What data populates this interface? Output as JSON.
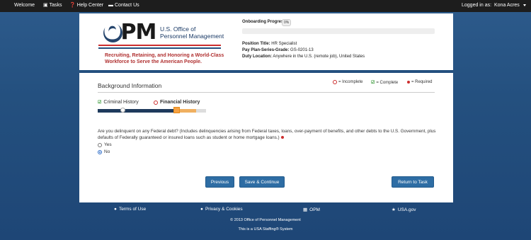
{
  "topnav": {
    "welcome": "Welcome",
    "tasks": "Tasks",
    "help_center": "Help Center",
    "contact_us": "Contact Us",
    "logged_in_as": "Logged in as:",
    "user": "Kona Acres"
  },
  "header": {
    "logo": {
      "brand": "OPM",
      "name_line1": "U.S. Office of",
      "name_line2": "Personnel Management",
      "tagline_line1": "Recruiting, Retaining, and Honoring a World-Class",
      "tagline_line2": "Workforce to Serve the American People."
    },
    "progress_label": "Onboarding Progress",
    "progress_value": "0%",
    "progress_fraction": 0,
    "position_title_label": "Position Title:",
    "position_title": "HR Specialist",
    "pay_plan_label": "Pay Plan-Series-Grade:",
    "pay_plan": "GS-0201-13",
    "duty_location_label": "Duty Location:",
    "duty_location": "Anywhere in the U.S. (remote job), United States"
  },
  "section": {
    "title": "Background Information",
    "legend": {
      "incomplete": "= Incomplete",
      "complete": "= Complete",
      "required": "= Required"
    },
    "steps": [
      {
        "label": "Criminal History",
        "status": "complete"
      },
      {
        "label": "Financial History",
        "status": "incomplete"
      }
    ],
    "question": "Are you delinquent on any Federal debt? (Includes delinquencies arising from Federal taxes, loans, over-payment of benefits, and other debts to the U.S. Government, plus defaults of Federally guaranteed or insured loans such as student or home mortgage loans.)",
    "options": [
      "Yes",
      "No"
    ],
    "selected": "No"
  },
  "buttons": {
    "previous": "Previous",
    "save_continue": "Save & Continue",
    "return_to_task": "Return to Task"
  },
  "footer": {
    "terms": "Terms of Use",
    "privacy": "Privacy & Cookies",
    "opm": "OPM",
    "usa_gov": "USA.gov",
    "copyright": "© 2013 Office of Personnel Management",
    "system": "This is a USA Staffing® System"
  },
  "colors": {
    "primary": "#2e6da4",
    "dark_blue": "#24507f",
    "incomplete": "#cc2e2e",
    "complete": "#3b9a3b",
    "step_active": "#f5a142"
  }
}
